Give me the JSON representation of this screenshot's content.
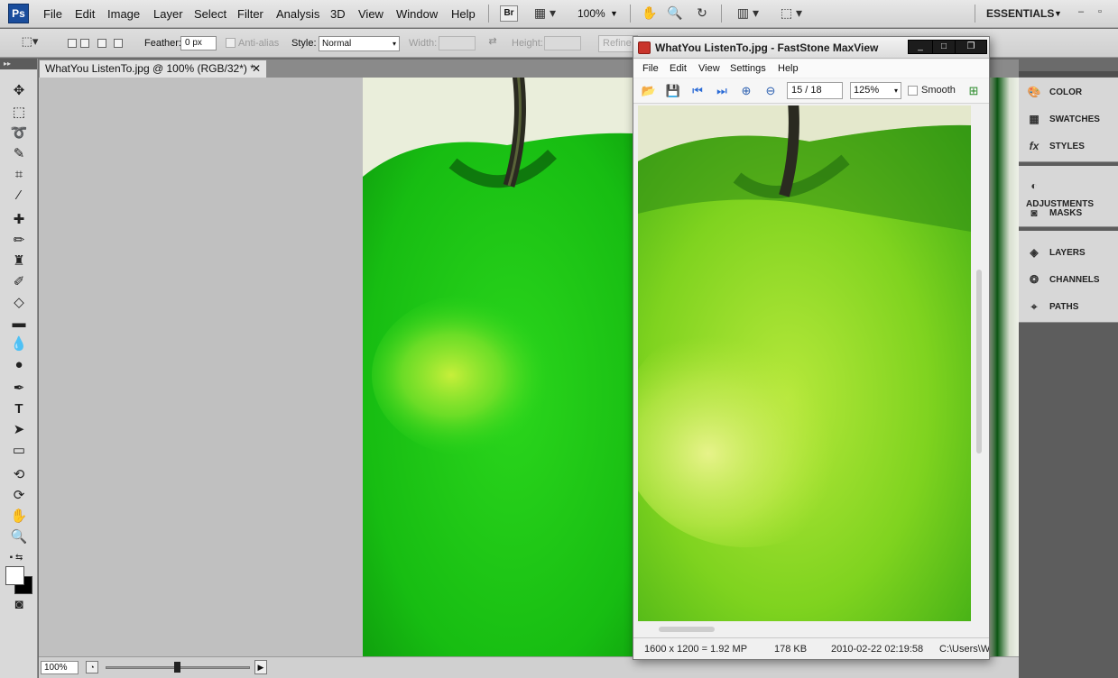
{
  "photoshop": {
    "logo": "Ps",
    "menu": [
      "File",
      "Edit",
      "Image",
      "Layer",
      "Select",
      "Filter",
      "Analysis",
      "3D",
      "View",
      "Window",
      "Help"
    ],
    "bridge_button": "Br",
    "zoom_menu": "100%",
    "workspace": "ESSENTIALS",
    "options": {
      "feather_label": "Feather:",
      "feather_value": "0 px",
      "antialias_label": "Anti-alias",
      "style_label": "Style:",
      "style_value": "Normal",
      "width_label": "Width:",
      "height_label": "Height:",
      "refine_label": "Refine"
    },
    "document_tab": "WhatYou ListenTo.jpg @ 100% (RGB/32*) *",
    "status_zoom": "100%",
    "panels": {
      "group1": [
        "COLOR",
        "SWATCHES",
        "STYLES"
      ],
      "group2": [
        "ADJUSTMENTS",
        "MASKS"
      ],
      "group3": [
        "LAYERS",
        "CHANNELS",
        "PATHS"
      ]
    }
  },
  "faststone": {
    "title": "WhatYou ListenTo.jpg - FastStone MaxView",
    "menu": [
      "File",
      "Edit",
      "View",
      "Settings",
      "Help"
    ],
    "page_field": "15 / 18",
    "zoom_value": "125%",
    "smooth_label": "Smooth",
    "status": {
      "dimensions": "1600 x 1200 = 1.92 MP",
      "filesize": "178 KB",
      "datetime": "2010-02-22 02:19:58",
      "path": "C:\\Users\\W"
    }
  }
}
